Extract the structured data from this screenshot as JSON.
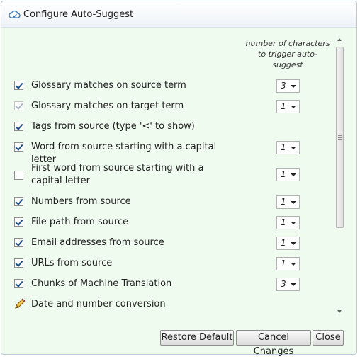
{
  "dialog": {
    "title": "Configure Auto-Suggest"
  },
  "column_header": "number of characters to trigger auto-suggest",
  "rows": [
    {
      "label": "Glossary matches on source term",
      "checked": true,
      "disabled": false,
      "value": "3"
    },
    {
      "label": "Glossary matches on target term",
      "checked": true,
      "disabled": true,
      "value": "1"
    },
    {
      "label": "Tags from source (type '<' to show)",
      "checked": true,
      "disabled": false,
      "value": null
    },
    {
      "label": "Word from source starting with a capital letter",
      "checked": true,
      "disabled": false,
      "value": "1"
    },
    {
      "label": "First word from source starting with a capital letter",
      "checked": false,
      "disabled": false,
      "value": "1"
    },
    {
      "label": "Numbers from source",
      "checked": true,
      "disabled": false,
      "value": "1"
    },
    {
      "label": "File path from source",
      "checked": true,
      "disabled": false,
      "value": "1"
    },
    {
      "label": "Email addresses from source",
      "checked": true,
      "disabled": false,
      "value": "1"
    },
    {
      "label": "URLs from source",
      "checked": true,
      "disabled": false,
      "value": "1"
    },
    {
      "label": "Chunks of Machine Translation",
      "checked": true,
      "disabled": false,
      "value": "3"
    },
    {
      "label": "Date and number conversion",
      "icon": "pencil-icon",
      "value": null
    }
  ],
  "buttons": {
    "restore_default": "Restore Default",
    "cancel_changes": "Cancel Changes",
    "close": "Close"
  },
  "colors": {
    "content_bg": "#f0fbf0",
    "checkmark": "#1f4f86",
    "border": "#b8c9d8"
  }
}
